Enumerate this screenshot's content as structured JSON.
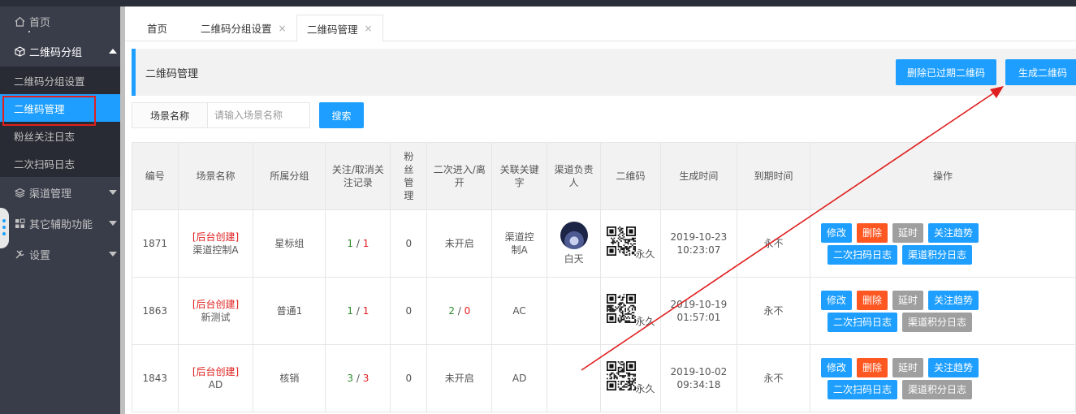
{
  "sidebar": {
    "home": "首页",
    "group_menu": "二维码分组",
    "sub_items": [
      "二维码分组设置",
      "二维码管理",
      "粉丝关注日志",
      "二次扫码日志"
    ],
    "channel_menu": "渠道管理",
    "other_menu": "其它辅助功能",
    "settings_menu": "设置"
  },
  "tabs": [
    {
      "label": "首页"
    },
    {
      "label": "二维码分组设置",
      "close": "×"
    },
    {
      "label": "二维码管理",
      "close": "×"
    }
  ],
  "panel": {
    "title": "二维码管理",
    "delete_expired": "删除已过期二维码",
    "generate": "生成二维码"
  },
  "search": {
    "label": "场景名称",
    "placeholder": "请输入场景名称",
    "button": "搜索"
  },
  "table": {
    "headers": [
      "编号",
      "场景名称",
      "所属分组",
      "关注/取消关注记录",
      "粉丝管理",
      "二次进入/离开",
      "关联关键字",
      "渠道负责人",
      "二维码",
      "生成时间",
      "到期时间",
      "操作"
    ],
    "rows": [
      {
        "id": "1871",
        "tag": "[后台创建]",
        "name": "渠道控制A",
        "group": "星标组",
        "follow_a": "1",
        "sep": " / ",
        "follow_b": "1",
        "fans": "0",
        "second": "未开启",
        "keyword": "渠道控制A",
        "owner": "白天",
        "qr_label": "永久",
        "date": "2019-10-23",
        "time": "10:23:07",
        "expire": "永不"
      },
      {
        "id": "1863",
        "tag": "[后台创建]",
        "name": "新测试",
        "group": "普通1",
        "follow_a": "1",
        "sep": " / ",
        "follow_b": "1",
        "fans": "0",
        "second_a": "2",
        "second_b": "0",
        "keyword": "AC",
        "owner": "",
        "qr_label": "永久",
        "date": "2019-10-19",
        "time": "01:57:01",
        "expire": "永不"
      },
      {
        "id": "1843",
        "tag": "[后台创建]",
        "name": "AD",
        "group": "核销",
        "follow_a": "3",
        "sep": " / ",
        "follow_b": "3",
        "fans": "0",
        "second": "未开启",
        "keyword": "AD",
        "owner": "",
        "qr_label": "永久",
        "date": "2019-10-02",
        "time": "09:34:18",
        "expire": "永不"
      }
    ],
    "ops": {
      "edit": "修改",
      "delete": "删除",
      "delay": "延时",
      "trend": "关注趋势",
      "second_log": "二次扫码日志",
      "channel_log": "渠道积分日志"
    }
  },
  "colors": {
    "accent": "#1e9fff",
    "danger": "#ff5722",
    "neutral": "#9f9f9f",
    "sidebar": "#393d49",
    "annotation": "#e02020"
  }
}
